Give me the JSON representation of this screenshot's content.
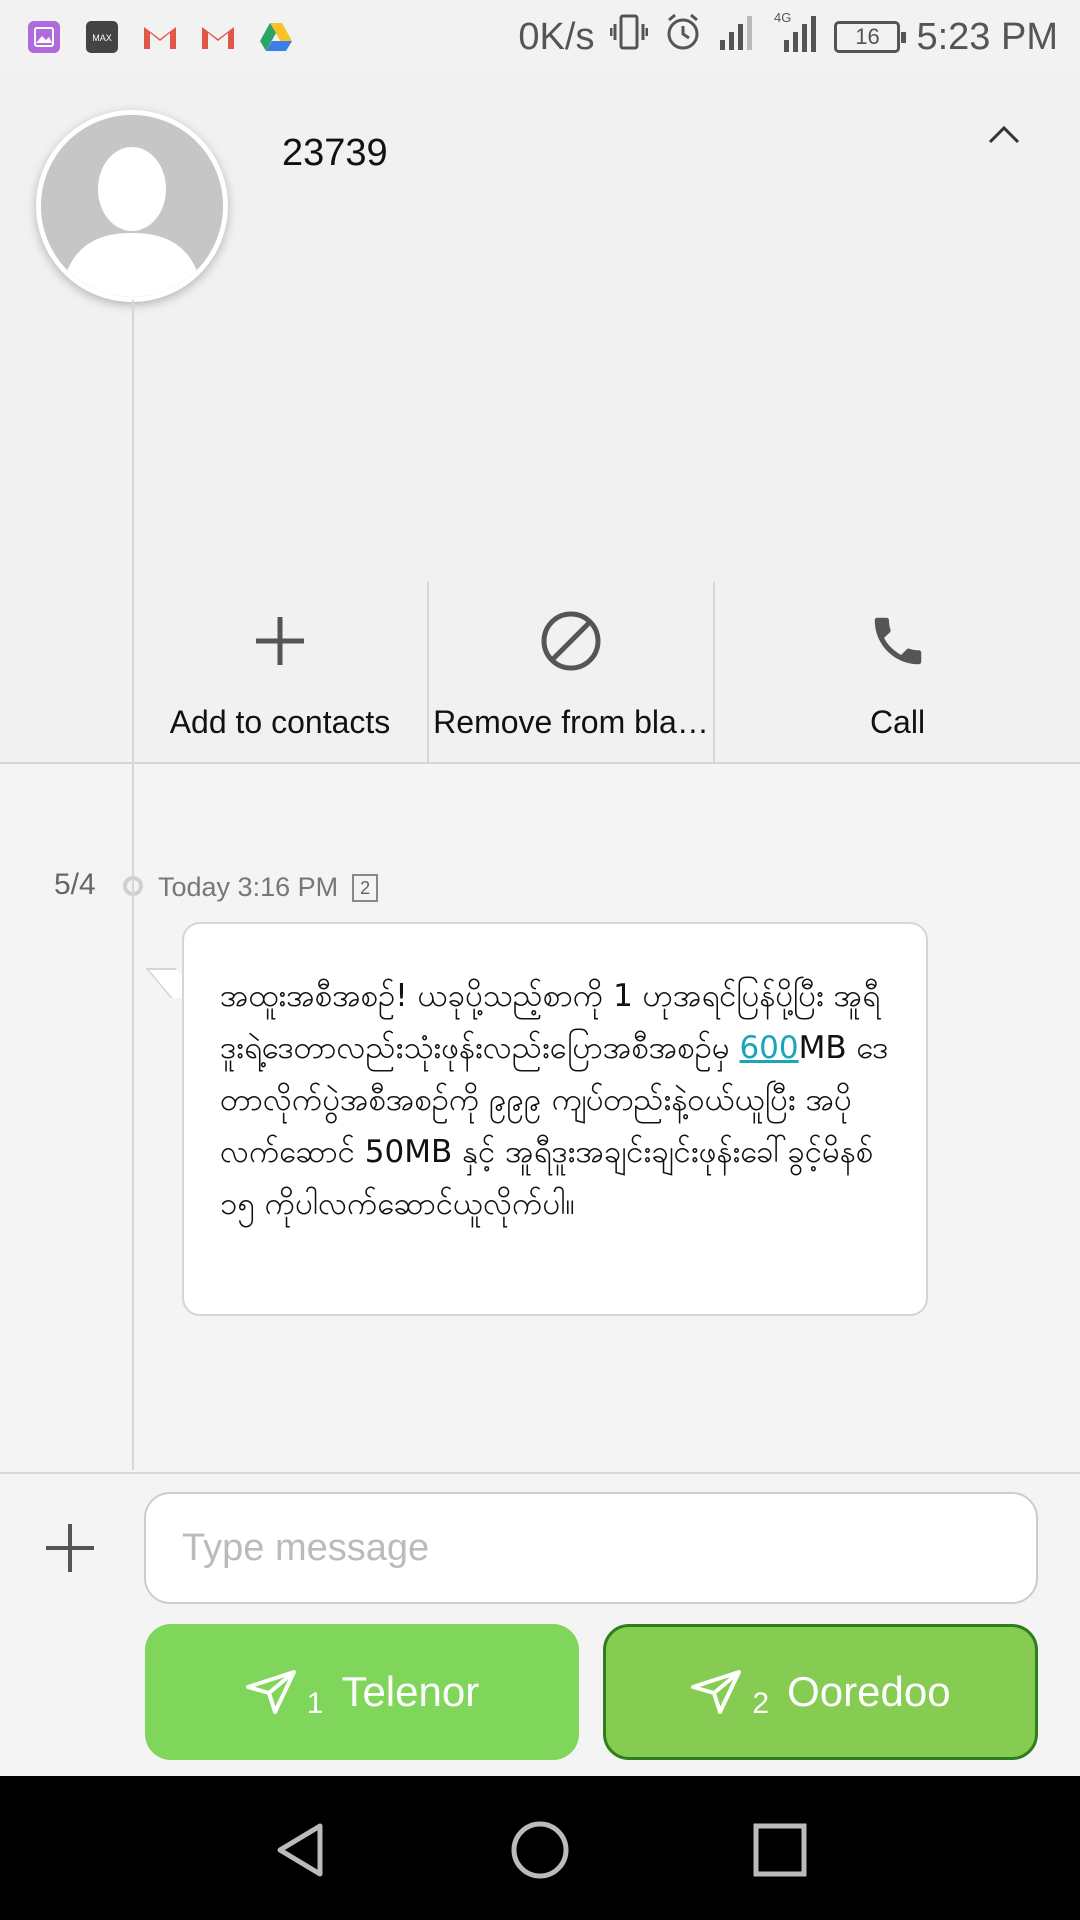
{
  "status_bar": {
    "left_icons": [
      "gallery-icon",
      "max-icon",
      "gmail-icon",
      "gmail-icon",
      "drive-icon"
    ],
    "net_speed": "0K/s",
    "battery_level": "16",
    "time": "5:23 PM"
  },
  "header": {
    "contact_number": "23739",
    "actions": [
      {
        "label": "Add to contacts",
        "icon": "plus-icon"
      },
      {
        "label": "Remove from bla…",
        "icon": "block-icon"
      },
      {
        "label": "Call",
        "icon": "phone-icon"
      }
    ]
  },
  "conversation": {
    "date": "5/4",
    "time_label": "Today 3:16 PM",
    "sim_badge": "2",
    "message": {
      "before_link": " အထူးအစီအစဉ်! ယခုပို့သည့်စာကို 1 ဟုအရင်ပြန်ပို့ပြီး အူရီဒူးရဲ့ဒေတာလည်းသုံးဖုန်းလည်းပြောအစီအစဉ်မှ ",
      "link": "600",
      "after_link": "MB ဒေတာလိုက်ပွဲအစီအစဉ်ကို ၉၉၉ ကျပ်တည်းနဲ့ဝယ်ယူပြီး အပိုလက်ဆောင် 50MB  နှင့်  အူရီဒူးအချင်းချင်းဖုန်းခေါ်ခွင့်မိနစ်  ၁၅ ကိုပါလက်ဆောင်ယူလိုက်ပါ။"
    }
  },
  "composer": {
    "placeholder": "Type message",
    "send_buttons": [
      {
        "sim": "1",
        "label": "Telenor",
        "color": "#7fd65a"
      },
      {
        "sim": "2",
        "label": "Ooredoo",
        "color": "#86cb52"
      }
    ]
  },
  "navbar": {
    "buttons": [
      "back-icon",
      "home-icon",
      "recents-icon"
    ]
  }
}
